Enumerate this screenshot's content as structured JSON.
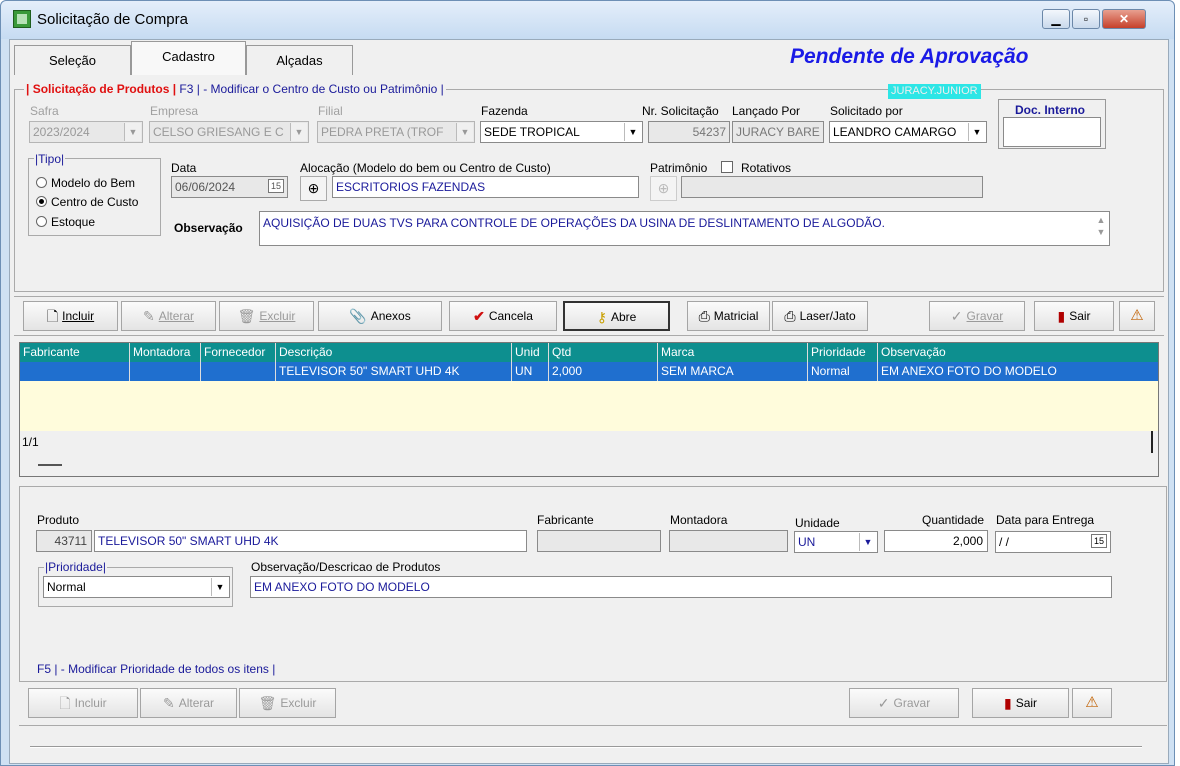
{
  "window": {
    "title": "Solicitação de Compra"
  },
  "tabs": [
    "Seleção",
    "Cadastro",
    "Alçadas"
  ],
  "status_text": "Pendente de Aprovação",
  "header": {
    "group_title_red": "| Solicitação de Produtos |",
    "group_title_blue": " F3 | - Modificar o Centro de Custo ou Patrimônio |",
    "user_badge": "JURACY.JUNIOR"
  },
  "fields": {
    "safra_label": "Safra",
    "safra_value": "2023/2024",
    "empresa_label": "Empresa",
    "empresa_value": "CELSO GRIESANG E C",
    "filial_label": "Filial",
    "filial_value": "PEDRA PRETA (TROF",
    "fazenda_label": "Fazenda",
    "fazenda_value": "SEDE TROPICAL",
    "nr_label": "Nr. Solicitação",
    "nr_value": "54237",
    "lancado_label": "Lançado Por",
    "lancado_value": "JURACY BARE",
    "solicitado_label": "Solicitado por",
    "solicitado_value": "LEANDRO CAMARGO",
    "doc_label": "Doc. Interno",
    "doc_value": "",
    "tipo_label": "Tipo",
    "tipo_options": [
      "Modelo do Bem",
      "Centro de Custo",
      "Estoque"
    ],
    "data_label": "Data",
    "data_value": "06/06/2024",
    "alocacao_label": "Alocação (Modelo do bem ou Centro de Custo)",
    "alocacao_value": "ESCRITORIOS FAZENDAS",
    "patrimonio_label": "Patrimônio",
    "rotativos_label": "Rotativos",
    "obs_label": "Observação",
    "obs_value": "AQUISIÇÃO DE DUAS TVS PARA CONTROLE DE OPERAÇÕES DA USINA DE DESLINTAMENTO DE ALGODÃO."
  },
  "toolbar": {
    "incluir": "Incluir",
    "alterar": "Alterar",
    "excluir": "Excluir",
    "anexos": "Anexos",
    "cancela": "Cancela",
    "abre": "Abre",
    "matricial": "Matricial",
    "laser": "Laser/Jato",
    "gravar": "Gravar",
    "sair": "Sair"
  },
  "grid": {
    "columns": [
      "Fabricante",
      "Montadora",
      "Fornecedor",
      "Descrição",
      "Unid",
      "Qtd",
      "Marca",
      "Prioridade",
      "Observação"
    ],
    "rows": [
      [
        "",
        "",
        "",
        "TELEVISOR 50\" SMART UHD 4K",
        "UN",
        "2,000",
        "SEM MARCA",
        "Normal",
        "EM ANEXO FOTO DO MODELO"
      ]
    ],
    "pager": "1/1"
  },
  "detail": {
    "produto_label": "Produto",
    "produto_code": "43711",
    "produto_desc": "TELEVISOR 50\" SMART UHD 4K",
    "fabricante_label": "Fabricante",
    "montadora_label": "Montadora",
    "unidade_label": "Unidade",
    "unidade_value": "UN",
    "quantidade_label": "Quantidade",
    "quantidade_value": "2,000",
    "entrega_label": "Data para Entrega",
    "entrega_value": " / /",
    "prioridade_label": "Prioridade",
    "prioridade_value": "Normal",
    "obs_label": "Observação/Descricao de Produtos",
    "obs_value": "EM ANEXO FOTO DO MODELO",
    "f5_hint": "F5 | - Modificar Prioridade de todos os itens |"
  },
  "bottom_toolbar": {
    "incluir": "Incluir",
    "alterar": "Alterar",
    "excluir": "Excluir",
    "gravar": "Gravar",
    "sair": "Sair"
  },
  "colors": {
    "status": "#1a1ae6",
    "grid_header": "#0d8f8f",
    "grid_selected": "#1f6fcf",
    "grid_bg": "#fffcdc",
    "badge": "#2de6e6"
  }
}
